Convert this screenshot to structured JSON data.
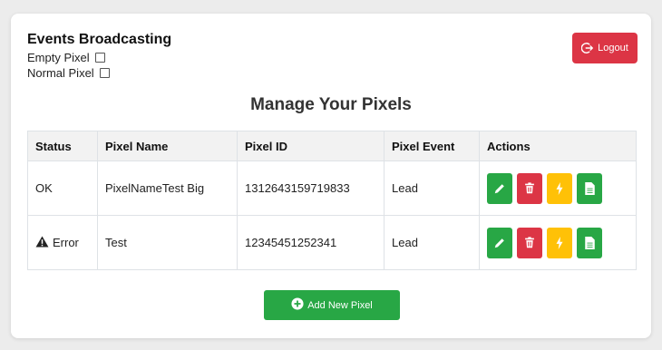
{
  "broadcast": {
    "title": "Events Broadcasting",
    "options": [
      {
        "label": "Empty Pixel",
        "checked": false
      },
      {
        "label": "Normal Pixel",
        "checked": false
      }
    ]
  },
  "header": {
    "logout_label": "Logout",
    "logout_icon": "logout-icon"
  },
  "main": {
    "title": "Manage Your Pixels",
    "columns": [
      "Status",
      "Pixel Name",
      "Pixel ID",
      "Pixel Event",
      "Actions"
    ],
    "rows": [
      {
        "status": "OK",
        "status_icon": "",
        "name": "PixelNameTest Big",
        "pixel_id": "1312643159719833",
        "event": "Lead"
      },
      {
        "status": "Error",
        "status_icon": "warning-icon",
        "name": "Test",
        "pixel_id": "12345451252341",
        "event": "Lead"
      }
    ],
    "actions": [
      {
        "name": "edit",
        "icon": "pencil-icon",
        "color": "#28a745"
      },
      {
        "name": "delete",
        "icon": "trash-icon",
        "color": "#dc3545"
      },
      {
        "name": "fire-event",
        "icon": "lightning-icon",
        "color": "#ffc107"
      },
      {
        "name": "details",
        "icon": "document-icon",
        "color": "#28a745"
      }
    ],
    "add_label": "Add New Pixel",
    "add_icon": "plus-circle-icon"
  },
  "colors": {
    "success": "#28a745",
    "danger": "#dc3545",
    "warning": "#ffc107"
  }
}
